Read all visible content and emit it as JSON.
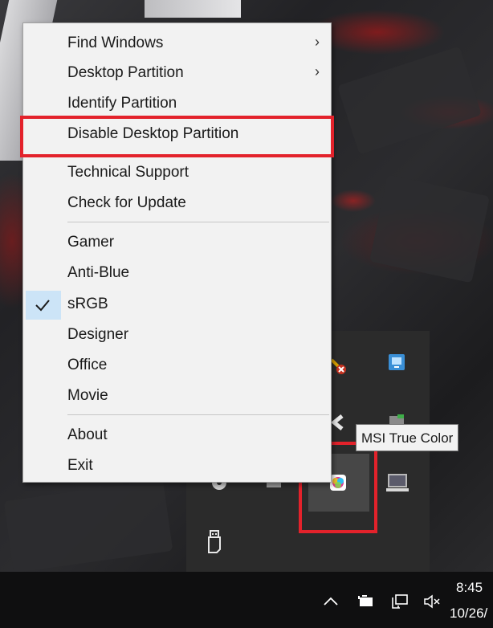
{
  "menu": {
    "items": [
      {
        "label": "Find Windows",
        "has_submenu": true,
        "submenu_glyph": "›"
      },
      {
        "label": "Desktop Partition",
        "has_submenu": true,
        "submenu_glyph": "›"
      },
      {
        "label": "Identify Partition"
      },
      {
        "label": "Disable Desktop Partition",
        "highlighted": true
      },
      {
        "label": "Technical Support"
      },
      {
        "label": "Check for Update"
      },
      {
        "label": "Gamer"
      },
      {
        "label": "Anti-Blue"
      },
      {
        "label": "sRGB",
        "checked": true
      },
      {
        "label": "Designer"
      },
      {
        "label": "Office"
      },
      {
        "label": "Movie"
      },
      {
        "label": "About"
      },
      {
        "label": "Exit"
      }
    ]
  },
  "tooltip": {
    "text": "MSI True Color"
  },
  "tray_overflow": {
    "icons": [
      "tools-error-icon",
      "network-monitor-icon",
      "back-chevron-icon",
      "green-app-icon",
      "disc-icon",
      "grey-app-icon",
      "msi-true-color-icon",
      "display-icon",
      "usb-drive-icon"
    ]
  },
  "taskbar": {
    "time": "8:45",
    "date": "10/26/",
    "tray_icons": [
      "show-hidden-icons-chevron",
      "battery-icon",
      "network-icon",
      "speaker-muted-icon"
    ]
  },
  "colors": {
    "highlight_border": "#e3222b",
    "menu_background": "#f2f2f2",
    "check_background": "#cce4f7",
    "taskbar": "#0f0f10"
  }
}
